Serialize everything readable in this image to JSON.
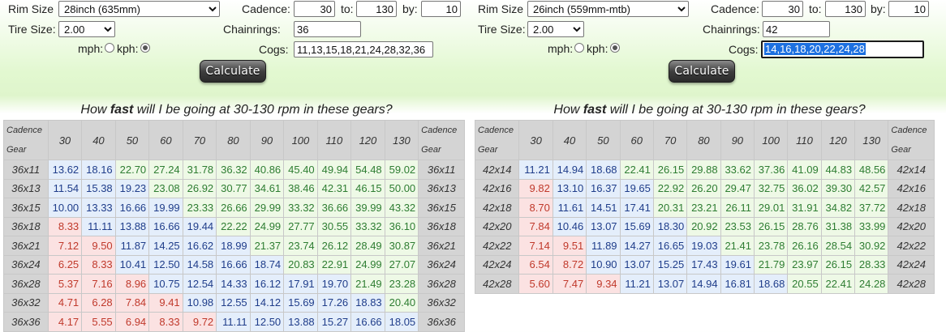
{
  "left": {
    "rim_label": "Rim Size",
    "rim_value": "28inch (635mm)",
    "tire_label": "Tire Size:",
    "tire_value": "2.00",
    "units": {
      "mph": "mph:",
      "kph": "kph:",
      "selected": "kph"
    },
    "cadence_label": "Cadence:",
    "cadence_from": "30",
    "to_label": "to:",
    "cadence_to": "130",
    "by_label": "by:",
    "cadence_by": "10",
    "chainrings_label": "Chainrings:",
    "chainrings_value": "36",
    "cogs_label": "Cogs:",
    "cogs_value": "11,13,15,18,21,24,28,32,36",
    "calculate_label": "Calculate",
    "question_pre": "How ",
    "question_bold": "fast",
    "question_post": " will I be going at 30-130 rpm in these gears?",
    "table": {
      "corner_top": "Cadence",
      "corner_bottom": "Gear",
      "cadences": [
        "30",
        "40",
        "50",
        "60",
        "70",
        "80",
        "90",
        "100",
        "110",
        "120",
        "130"
      ],
      "rows": [
        {
          "gear": "36x11",
          "values": [
            "13.62",
            "18.16",
            "22.70",
            "27.24",
            "31.78",
            "36.32",
            "40.86",
            "45.40",
            "49.94",
            "54.48",
            "59.02"
          ]
        },
        {
          "gear": "36x13",
          "values": [
            "11.54",
            "15.38",
            "19.23",
            "23.08",
            "26.92",
            "30.77",
            "34.61",
            "38.46",
            "42.31",
            "46.15",
            "50.00"
          ]
        },
        {
          "gear": "36x15",
          "values": [
            "10.00",
            "13.33",
            "16.66",
            "19.99",
            "23.33",
            "26.66",
            "29.99",
            "33.32",
            "36.66",
            "39.99",
            "43.32"
          ]
        },
        {
          "gear": "36x18",
          "values": [
            "8.33",
            "11.11",
            "13.88",
            "16.66",
            "19.44",
            "22.22",
            "24.99",
            "27.77",
            "30.55",
            "33.32",
            "36.10"
          ]
        },
        {
          "gear": "36x21",
          "values": [
            "7.12",
            "9.50",
            "11.87",
            "14.25",
            "16.62",
            "18.99",
            "21.37",
            "23.74",
            "26.12",
            "28.49",
            "30.87"
          ]
        },
        {
          "gear": "36x24",
          "values": [
            "6.25",
            "8.33",
            "10.41",
            "12.50",
            "14.58",
            "16.66",
            "18.74",
            "20.83",
            "22.91",
            "24.99",
            "27.07"
          ]
        },
        {
          "gear": "36x28",
          "values": [
            "5.37",
            "7.16",
            "8.96",
            "10.75",
            "12.54",
            "14.33",
            "16.12",
            "17.91",
            "19.70",
            "21.49",
            "23.28"
          ]
        },
        {
          "gear": "36x32",
          "values": [
            "4.71",
            "6.28",
            "7.84",
            "9.41",
            "10.98",
            "12.55",
            "14.12",
            "15.69",
            "17.26",
            "18.83",
            "20.40"
          ]
        },
        {
          "gear": "36x36",
          "values": [
            "4.17",
            "5.55",
            "6.94",
            "8.33",
            "9.72",
            "11.11",
            "12.50",
            "13.88",
            "15.27",
            "16.66",
            "18.05"
          ]
        }
      ]
    }
  },
  "right": {
    "rim_label": "Rim Size",
    "rim_value": "26inch (559mm-mtb)",
    "tire_label": "Tire Size:",
    "tire_value": "2.00",
    "units": {
      "mph": "mph:",
      "kph": "kph:",
      "selected": "kph"
    },
    "cadence_label": "Cadence:",
    "cadence_from": "30",
    "to_label": "to:",
    "cadence_to": "130",
    "by_label": "by:",
    "cadence_by": "10",
    "chainrings_label": "Chainrings:",
    "chainrings_value": "42",
    "cogs_label": "Cogs:",
    "cogs_value": "14,16,18,20,22,24,28",
    "calculate_label": "Calculate",
    "question_pre": "How ",
    "question_bold": "fast",
    "question_post": " will I be going at 30-130 rpm in these gears?",
    "table": {
      "corner_top": "Cadence",
      "corner_bottom": "Gear",
      "cadences": [
        "30",
        "40",
        "50",
        "60",
        "70",
        "80",
        "90",
        "100",
        "110",
        "120",
        "130"
      ],
      "rows": [
        {
          "gear": "42x14",
          "values": [
            "11.21",
            "14.94",
            "18.68",
            "22.41",
            "26.15",
            "29.88",
            "33.62",
            "37.36",
            "41.09",
            "44.83",
            "48.56"
          ]
        },
        {
          "gear": "42x16",
          "values": [
            "9.82",
            "13.10",
            "16.37",
            "19.65",
            "22.92",
            "26.20",
            "29.47",
            "32.75",
            "36.02",
            "39.30",
            "42.57"
          ]
        },
        {
          "gear": "42x18",
          "values": [
            "8.70",
            "11.61",
            "14.51",
            "17.41",
            "20.31",
            "23.21",
            "26.11",
            "29.01",
            "31.91",
            "34.82",
            "37.72"
          ]
        },
        {
          "gear": "42x20",
          "values": [
            "7.84",
            "10.46",
            "13.07",
            "15.69",
            "18.30",
            "20.92",
            "23.53",
            "26.15",
            "28.76",
            "31.38",
            "33.99"
          ]
        },
        {
          "gear": "42x22",
          "values": [
            "7.14",
            "9.51",
            "11.89",
            "14.27",
            "16.65",
            "19.03",
            "21.41",
            "23.78",
            "26.16",
            "28.54",
            "30.92"
          ]
        },
        {
          "gear": "42x24",
          "values": [
            "6.54",
            "8.72",
            "10.90",
            "13.07",
            "15.25",
            "17.43",
            "19.61",
            "21.79",
            "23.97",
            "26.15",
            "28.33"
          ]
        },
        {
          "gear": "42x28",
          "values": [
            "5.60",
            "7.47",
            "9.34",
            "11.21",
            "13.07",
            "14.94",
            "16.81",
            "18.68",
            "20.55",
            "22.41",
            "24.28"
          ]
        }
      ]
    }
  },
  "colors": {
    "slow": "#c0392b",
    "mid": "#1f3d8a",
    "fast": "#2e7d32",
    "header_bg": "#d4d4d4"
  }
}
